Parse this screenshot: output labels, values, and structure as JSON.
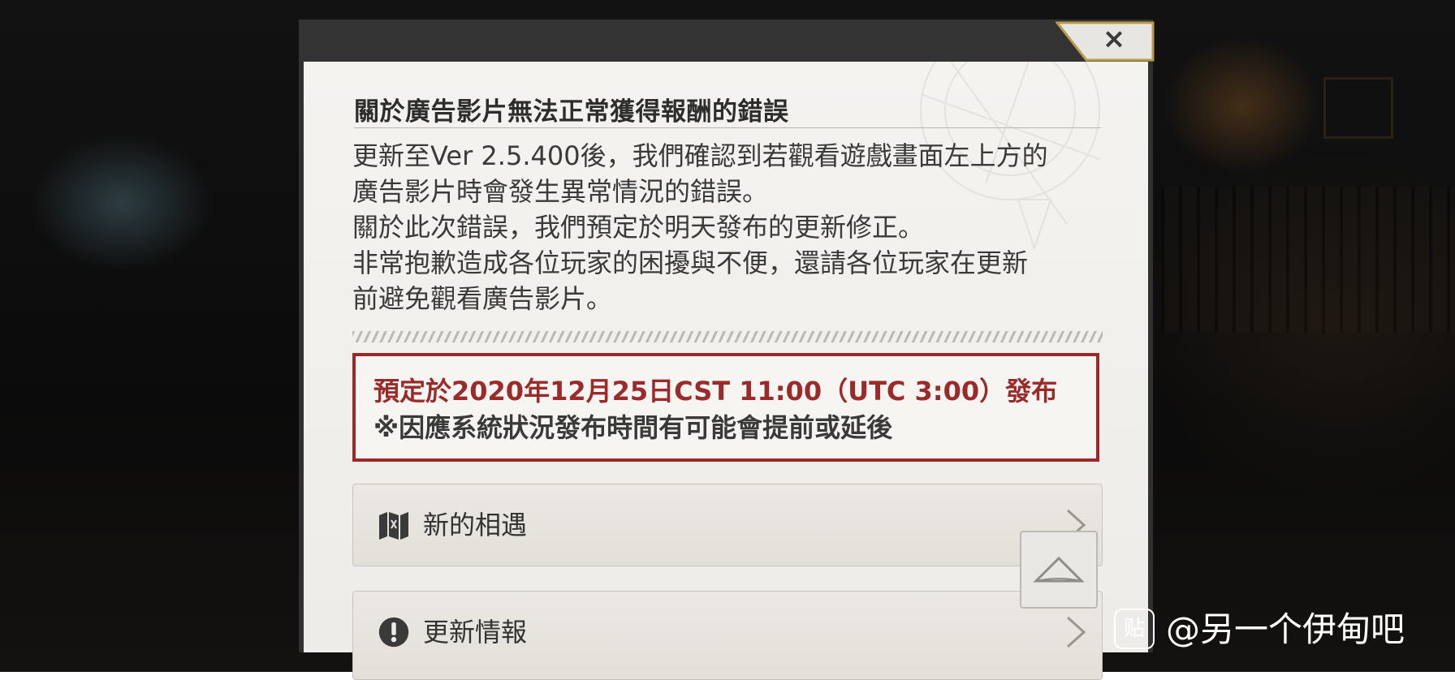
{
  "dialog": {
    "close_label": "×",
    "title": "關於廣告影片無法正常獲得報酬的錯誤",
    "body_lines": [
      "更新至Ver 2.5.400後，我們確認到若觀看遊戲畫面左上方的",
      "廣告影片時會發生異常情況的錯誤。",
      "關於此次錯誤，我們預定於明天發布的更新修正。",
      "非常抱歉造成各位玩家的困擾與不便，還請各位玩家在更新",
      "前避免觀看廣告影片。"
    ],
    "notice": {
      "line1": "預定於2020年12月25日CST 11:00（UTC 3:00）發布",
      "line2": "※因應系統狀況發布時間有可能會提前或延後",
      "accent_color": "#9b2b2b"
    },
    "menu": [
      {
        "label": "新的相遇",
        "icon": "map-scroll-icon"
      },
      {
        "label": "更新情報",
        "icon": "exclamation-icon"
      }
    ]
  },
  "watermark": {
    "logo_text": "贴",
    "text": "@另一个伊甸吧"
  }
}
